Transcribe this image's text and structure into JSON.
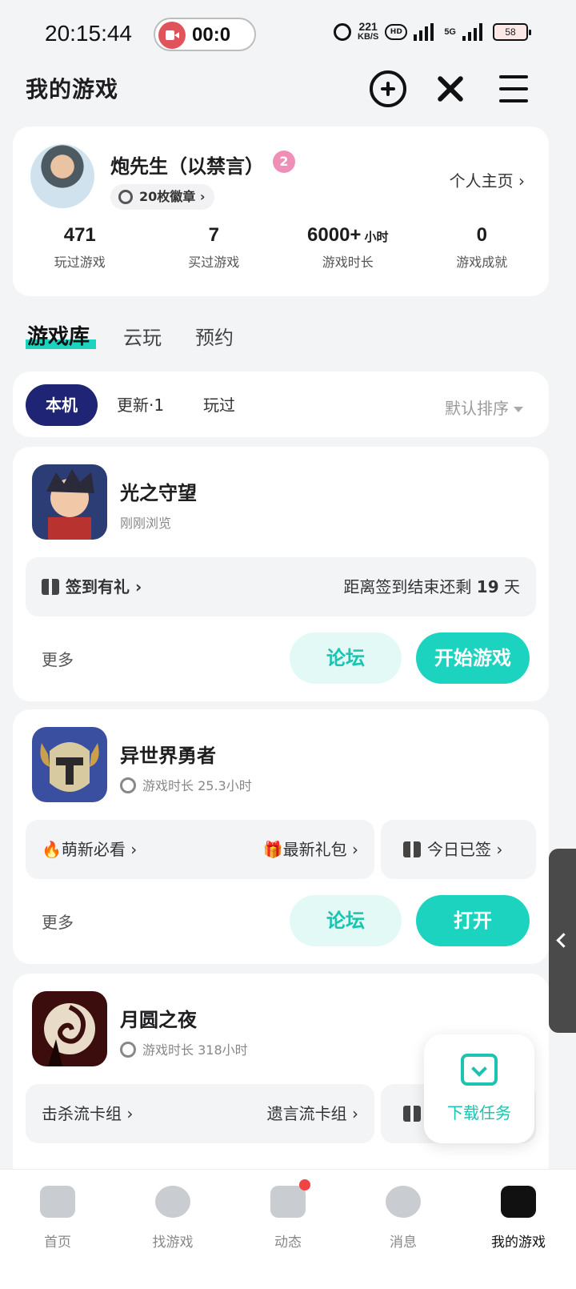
{
  "status_bar": {
    "time": "20:15:44",
    "recording": "00:0",
    "net_speed": "221",
    "net_unit": "KB/S",
    "hd": "HD",
    "network": "5G",
    "battery": "58"
  },
  "header": {
    "title": "我的游戏"
  },
  "profile": {
    "name": "炮先生（以禁言）",
    "level": "2",
    "badges": "20枚徽章 ›",
    "homepage": "个人主页 ›",
    "stats": [
      {
        "value": "471",
        "unit": "",
        "label": "玩过游戏"
      },
      {
        "value": "7",
        "unit": "",
        "label": "买过游戏"
      },
      {
        "value": "6000+",
        "unit": "小时",
        "label": "游戏时长"
      },
      {
        "value": "0",
        "unit": "",
        "label": "游戏成就"
      }
    ]
  },
  "tabs": [
    "游戏库",
    "云玩",
    "预约"
  ],
  "filters": {
    "chips": [
      "本机",
      "更新·1",
      "玩过"
    ],
    "sort": "默认排序"
  },
  "games": [
    {
      "name": "光之守望",
      "sub": "刚刚浏览",
      "left": "签到有礼 ›",
      "right_pre": "距离签到结束还剩 ",
      "right_num": "19",
      "right_post": " 天",
      "more": "更多",
      "forum": "论坛",
      "action": "开始游戏"
    },
    {
      "name": "异世界勇者",
      "sub": "游戏时长 25.3小时",
      "tag1": "🔥萌新必看 ›",
      "tag2": "🎁最新礼包 ›",
      "tag3": "今日已签 ›",
      "more": "更多",
      "forum": "论坛",
      "action": "打开"
    },
    {
      "name": "月圆之夜",
      "sub": "游戏时长 318小时",
      "tag1": "击杀流卡组 ›",
      "tag2": "遗言流卡组 ›"
    }
  ],
  "download": {
    "label": "下载任务"
  },
  "bottom_nav": [
    "首页",
    "找游戏",
    "动态",
    "消息",
    "我的游戏"
  ],
  "colors": {
    "accent": "#1cd3c0",
    "chip_active": "#1f2474"
  }
}
